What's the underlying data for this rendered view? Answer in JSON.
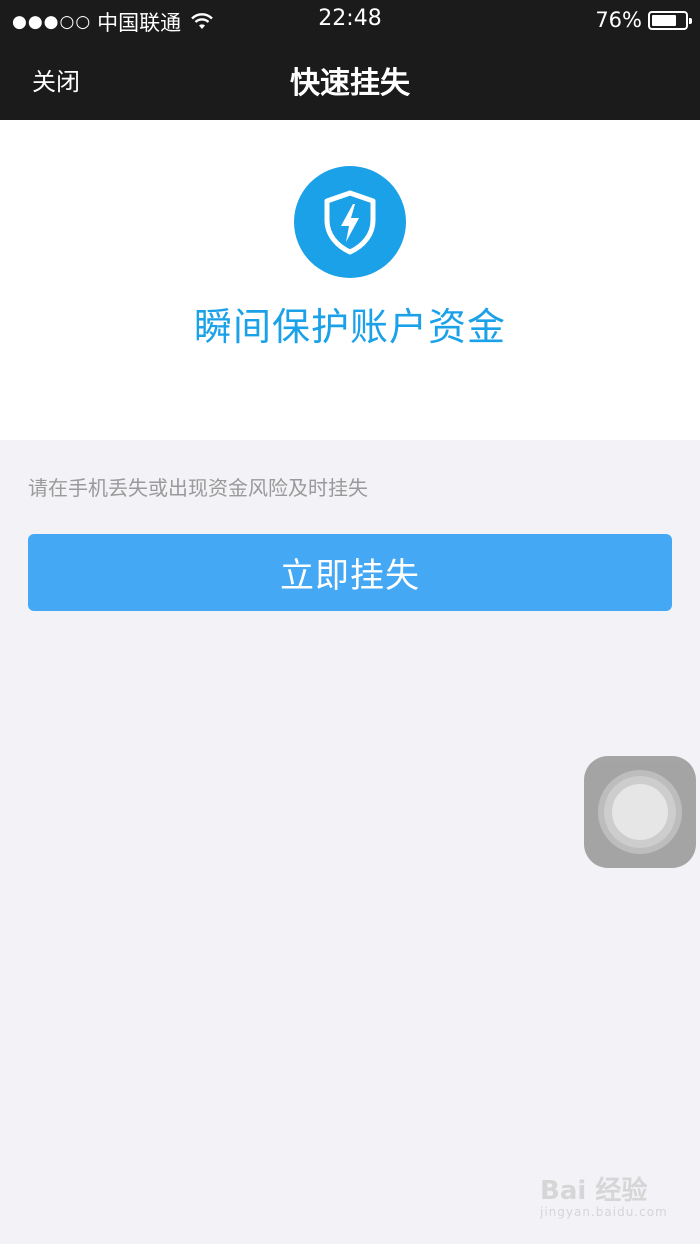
{
  "status_bar": {
    "signal": "●●●○○",
    "carrier": "中国联通",
    "time": "22:48",
    "battery_percent": "76%",
    "battery_level": 0.76
  },
  "navbar": {
    "close_label": "关闭",
    "title": "快速挂失"
  },
  "hero": {
    "icon": "shield-lightning-icon",
    "title": "瞬间保护账户资金"
  },
  "hint_text": "请在手机丢失或出现资金风险及时挂失",
  "primary_button": "立即挂失",
  "watermark": {
    "main": "Bai 经验",
    "sub": "jingyan.baidu.com"
  },
  "colors": {
    "accent": "#1aa1e8",
    "button": "#44a8f5",
    "navbar_bg": "#1b1b1b",
    "page_bg": "#f2f2f7"
  }
}
